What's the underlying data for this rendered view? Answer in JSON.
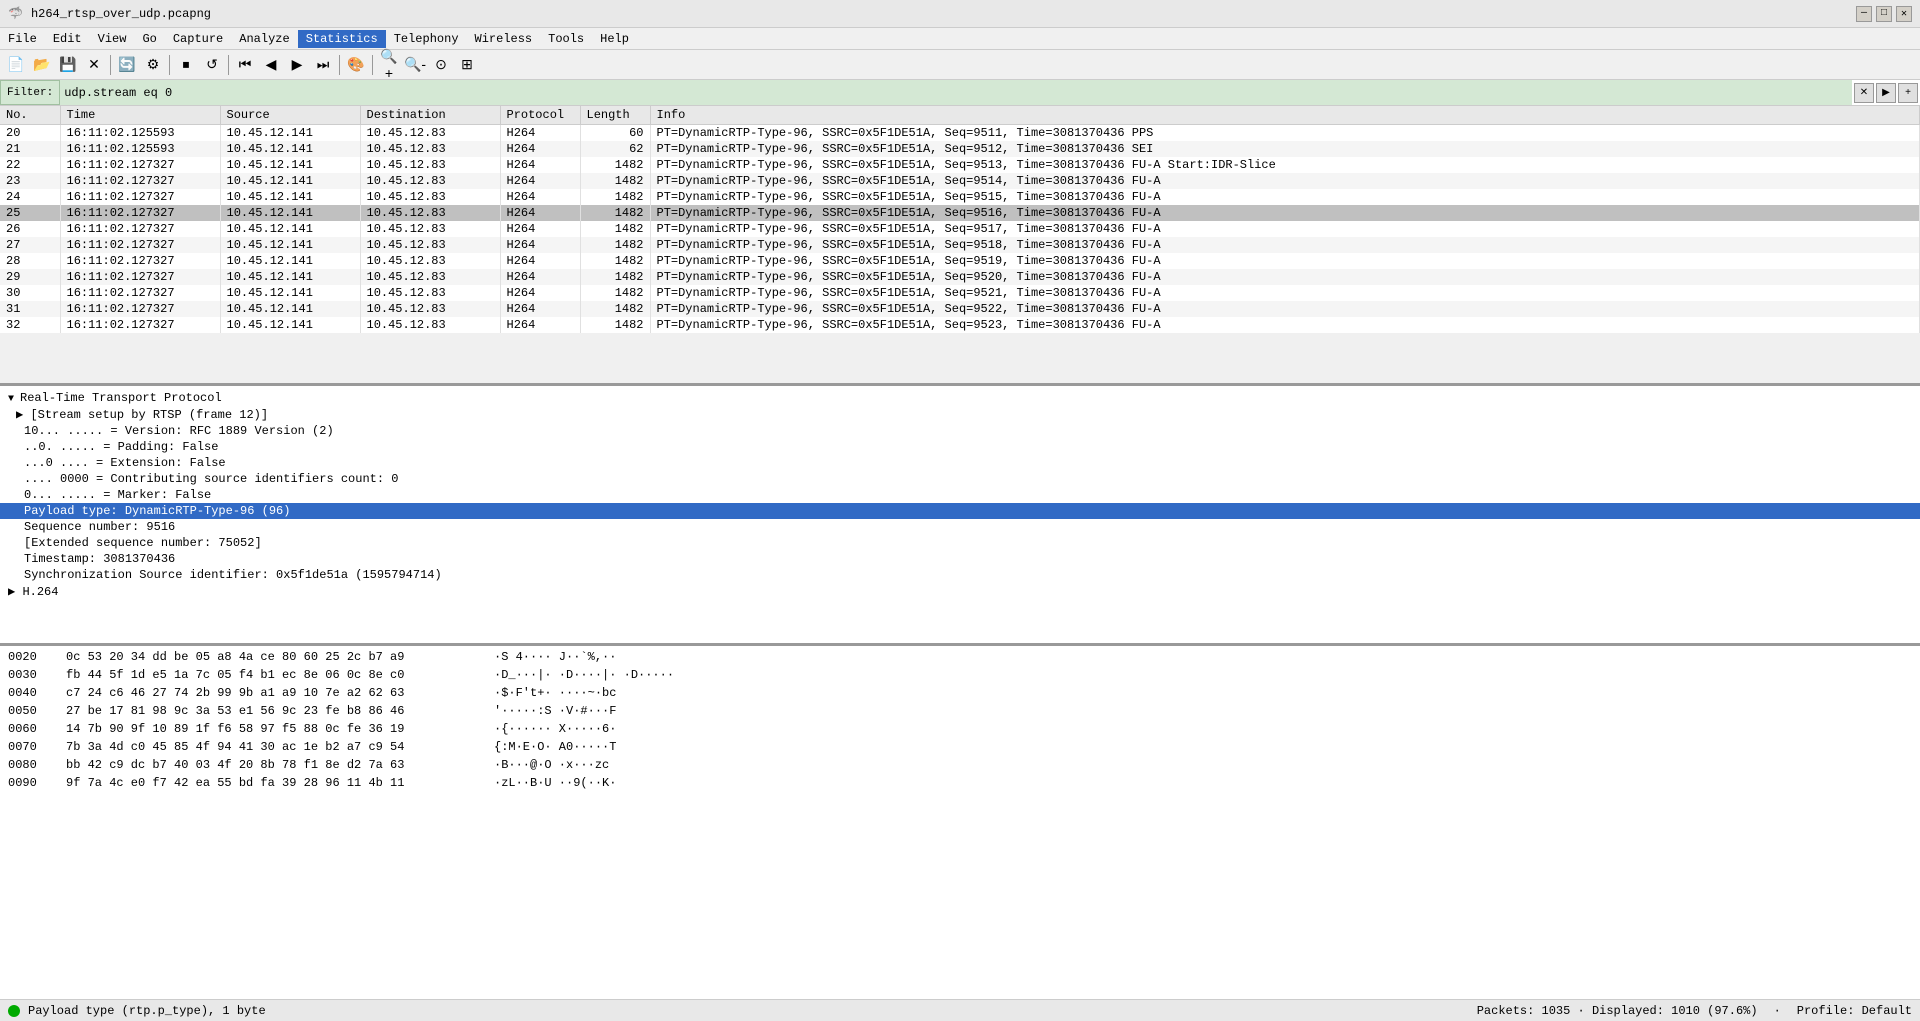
{
  "titlebar": {
    "title": "h264_rtsp_over_udp.pcapng",
    "icon": "🦈"
  },
  "menubar": {
    "items": [
      "File",
      "Edit",
      "View",
      "Go",
      "Capture",
      "Analyze",
      "Statistics",
      "Telephony",
      "Wireless",
      "Tools",
      "Help"
    ],
    "active_index": 6
  },
  "filter": {
    "value": "udp.stream eq 0"
  },
  "table": {
    "columns": [
      "No.",
      "Time",
      "Source",
      "Destination",
      "Protocol",
      "Length",
      "Info"
    ],
    "rows": [
      {
        "no": "20",
        "time": "16:11:02.125593",
        "src": "10.45.12.141",
        "dst": "10.45.12.83",
        "proto": "H264",
        "len": "60",
        "info": "PT=DynamicRTP-Type-96, SSRC=0x5F1DE51A, Seq=9511, Time=3081370436 PPS",
        "selected": false,
        "highlighted": false
      },
      {
        "no": "21",
        "time": "16:11:02.125593",
        "src": "10.45.12.141",
        "dst": "10.45.12.83",
        "proto": "H264",
        "len": "62",
        "info": "PT=DynamicRTP-Type-96, SSRC=0x5F1DE51A, Seq=9512, Time=3081370436 SEI",
        "selected": false,
        "highlighted": false
      },
      {
        "no": "22",
        "time": "16:11:02.127327",
        "src": "10.45.12.141",
        "dst": "10.45.12.83",
        "proto": "H264",
        "len": "1482",
        "info": "PT=DynamicRTP-Type-96, SSRC=0x5F1DE51A, Seq=9513, Time=3081370436 FU-A Start:IDR-Slice",
        "selected": false,
        "highlighted": false
      },
      {
        "no": "23",
        "time": "16:11:02.127327",
        "src": "10.45.12.141",
        "dst": "10.45.12.83",
        "proto": "H264",
        "len": "1482",
        "info": "PT=DynamicRTP-Type-96, SSRC=0x5F1DE51A, Seq=9514, Time=3081370436 FU-A",
        "selected": false,
        "highlighted": false
      },
      {
        "no": "24",
        "time": "16:11:02.127327",
        "src": "10.45.12.141",
        "dst": "10.45.12.83",
        "proto": "H264",
        "len": "1482",
        "info": "PT=DynamicRTP-Type-96, SSRC=0x5F1DE51A, Seq=9515, Time=3081370436 FU-A",
        "selected": false,
        "highlighted": false
      },
      {
        "no": "25",
        "time": "16:11:02.127327",
        "src": "10.45.12.141",
        "dst": "10.45.12.83",
        "proto": "H264",
        "len": "1482",
        "info": "PT=DynamicRTP-Type-96, SSRC=0x5F1DE51A, Seq=9516, Time=3081370436 FU-A",
        "selected": true,
        "highlighted": false
      },
      {
        "no": "26",
        "time": "16:11:02.127327",
        "src": "10.45.12.141",
        "dst": "10.45.12.83",
        "proto": "H264",
        "len": "1482",
        "info": "PT=DynamicRTP-Type-96, SSRC=0x5F1DE51A, Seq=9517, Time=3081370436 FU-A",
        "selected": false,
        "highlighted": false
      },
      {
        "no": "27",
        "time": "16:11:02.127327",
        "src": "10.45.12.141",
        "dst": "10.45.12.83",
        "proto": "H264",
        "len": "1482",
        "info": "PT=DynamicRTP-Type-96, SSRC=0x5F1DE51A, Seq=9518, Time=3081370436 FU-A",
        "selected": false,
        "highlighted": false
      },
      {
        "no": "28",
        "time": "16:11:02.127327",
        "src": "10.45.12.141",
        "dst": "10.45.12.83",
        "proto": "H264",
        "len": "1482",
        "info": "PT=DynamicRTP-Type-96, SSRC=0x5F1DE51A, Seq=9519, Time=3081370436 FU-A",
        "selected": false,
        "highlighted": false
      },
      {
        "no": "29",
        "time": "16:11:02.127327",
        "src": "10.45.12.141",
        "dst": "10.45.12.83",
        "proto": "H264",
        "len": "1482",
        "info": "PT=DynamicRTP-Type-96, SSRC=0x5F1DE51A, Seq=9520, Time=3081370436 FU-A",
        "selected": false,
        "highlighted": false
      },
      {
        "no": "30",
        "time": "16:11:02.127327",
        "src": "10.45.12.141",
        "dst": "10.45.12.83",
        "proto": "H264",
        "len": "1482",
        "info": "PT=DynamicRTP-Type-96, SSRC=0x5F1DE51A, Seq=9521, Time=3081370436 FU-A",
        "selected": false,
        "highlighted": false
      },
      {
        "no": "31",
        "time": "16:11:02.127327",
        "src": "10.45.12.141",
        "dst": "10.45.12.83",
        "proto": "H264",
        "len": "1482",
        "info": "PT=DynamicRTP-Type-96, SSRC=0x5F1DE51A, Seq=9522, Time=3081370436 FU-A",
        "selected": false,
        "highlighted": false
      },
      {
        "no": "32",
        "time": "16:11:02.127327",
        "src": "10.45.12.141",
        "dst": "10.45.12.83",
        "proto": "H264",
        "len": "1482",
        "info": "PT=DynamicRTP-Type-96, SSRC=0x5F1DE51A, Seq=9523, Time=3081370436 FU-A",
        "selected": false,
        "highlighted": false
      }
    ]
  },
  "detail": {
    "sections": [
      {
        "label": "Real-Time Transport Protocol",
        "expanded": true,
        "items": [
          {
            "text": "[Stream setup by RTSP (frame 12)]",
            "expandable": true,
            "highlighted": false
          },
          {
            "text": "10... ..... = Version: RFC 1889 Version (2)",
            "highlighted": false
          },
          {
            "text": "..0. ..... = Padding: False",
            "highlighted": false
          },
          {
            "text": "...0 .... = Extension: False",
            "highlighted": false
          },
          {
            "text": ".... 0000 = Contributing source identifiers count: 0",
            "highlighted": false
          },
          {
            "text": "0... ..... = Marker: False",
            "highlighted": false
          },
          {
            "text": "Payload type: DynamicRTP-Type-96 (96)",
            "highlighted": true
          },
          {
            "text": "Sequence number: 9516",
            "highlighted": false
          },
          {
            "text": "[Extended sequence number: 75052]",
            "highlighted": false
          },
          {
            "text": "Timestamp: 3081370436",
            "highlighted": false
          },
          {
            "text": "Synchronization Source identifier: 0x5f1de51a (1595794714)",
            "highlighted": false
          }
        ]
      },
      {
        "label": "H.264",
        "expanded": false,
        "items": []
      }
    ]
  },
  "hex": {
    "rows": [
      {
        "offset": "0020",
        "bytes": "0c 53 20 34 dd be 05 a8  4a ce 80 60 25 2c b7 a9",
        "ascii": "·S 4····  J··`%,··"
      },
      {
        "offset": "0030",
        "bytes": "fb 44 5f 1d e5 1a 7c 05  f4 b1 ec 8e 06 0c 8e c0",
        "ascii": "·D_···|·  ·D····|·  ·D·····"
      },
      {
        "offset": "0040",
        "bytes": "c7 24 c6 46 27 74 2b 99  9b a1 a9 10 7e a2 62 63",
        "ascii": "·$·F't+·  ····~·bc"
      },
      {
        "offset": "0050",
        "bytes": "27 be 17 81 98 9c 3a 53  e1 56 9c 23 fe b8 86 46",
        "ascii": "'·····:S  ·V·#···F"
      },
      {
        "offset": "0060",
        "bytes": "14 7b 90 9f 10 89 1f f6  58 97 f5 88 0c fe 36 19",
        "ascii": "·{······  X·····6·"
      },
      {
        "offset": "0070",
        "bytes": "7b 3a 4d c0 45 85 4f 94  41 30 ac 1e b2 a7 c9 54",
        "ascii": "{:M·E·O·  A0·····T"
      },
      {
        "offset": "0080",
        "bytes": "bb 42 c9 dc b7 40 03 4f  20 8b 78 f1 8e d2 7a 63",
        "ascii": "·B···@·O  ·x···zc"
      },
      {
        "offset": "0090",
        "bytes": "9f 7a 4c e0 f7 42 ea 55  bd fa 39 28 96 11 4b 11",
        "ascii": "·zL··B·U  ··9(··K·"
      }
    ]
  },
  "statusbar": {
    "left_text": "Payload type (rtp.p_type), 1 byte",
    "stats": "Packets: 1035 · Displayed: 1010 (97.6%)",
    "profile": "Profile: Default"
  }
}
